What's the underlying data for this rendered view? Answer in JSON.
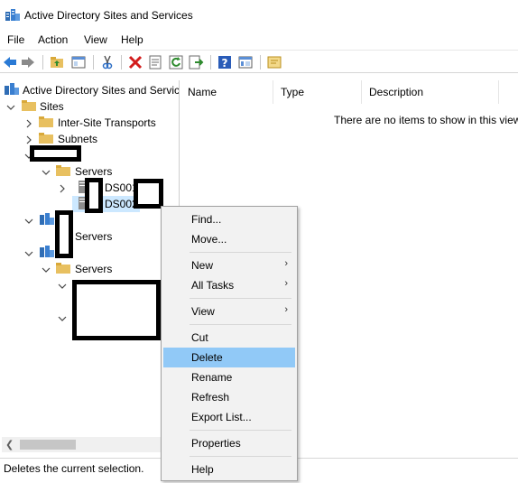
{
  "window": {
    "title": "Active Directory Sites and Services"
  },
  "menu": {
    "items": [
      "File",
      "Action",
      "View",
      "Help"
    ]
  },
  "toolbar": {
    "buttons": [
      "back-icon",
      "forward-icon",
      "up-folder-icon",
      "show-hide-tree-icon",
      "cut-icon",
      "delete-icon",
      "properties-icon",
      "refresh-icon",
      "export-list-icon",
      "help-icon",
      "view-icon",
      "new-icon"
    ]
  },
  "tree": {
    "root": "Active Directory Sites and Servic",
    "sites": "Sites",
    "inter_site": "Inter-Site Transports",
    "subnets": "Subnets",
    "servers_1": "Servers",
    "server_a": "DS001",
    "server_b": "DS002",
    "servers_2": "Servers",
    "servers_3": "Servers"
  },
  "list": {
    "columns": [
      "Name",
      "Type",
      "Description"
    ],
    "empty_message": "There are no items to show in this view"
  },
  "context_menu": {
    "find": "Find...",
    "move": "Move...",
    "new": "New",
    "all_tasks": "All Tasks",
    "view": "View",
    "cut": "Cut",
    "delete": "Delete",
    "rename": "Rename",
    "refresh": "Refresh",
    "export": "Export List...",
    "properties": "Properties",
    "help": "Help",
    "submenu_arrow": "›",
    "highlighted": "Delete"
  },
  "status": {
    "text": "Deletes the current selection."
  },
  "colors": {
    "highlight": "#91c9f7",
    "selection": "#cce8ff",
    "folder": "#e8c060"
  }
}
